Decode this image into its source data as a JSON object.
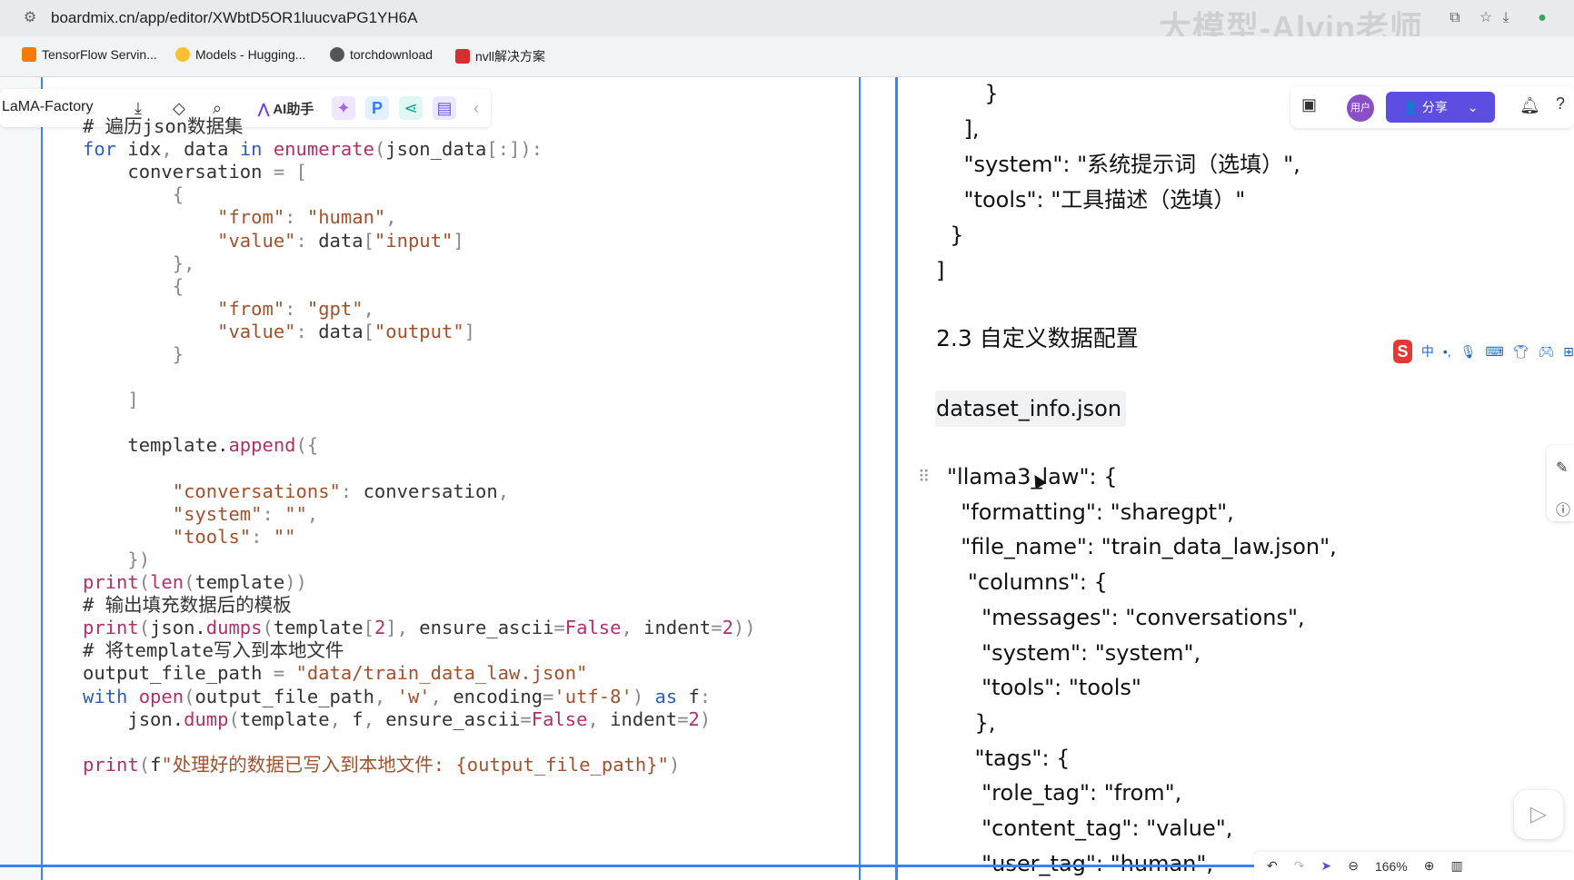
{
  "browser": {
    "url": "boardmix.cn/app/editor/XWbtD5OR1luucvaPG1YH6A",
    "watermark": "大模型-Alvin老师",
    "bookmarks": [
      "TensorFlow Servin...",
      "Models - Hugging...",
      "torchdownload",
      "nvll解决方案"
    ]
  },
  "toolbar": {
    "doc_name": "LaMA-Factory",
    "ai_label": "AI助手"
  },
  "right_bar": {
    "avatar": "用户",
    "share": "分享"
  },
  "ime": {
    "logo": "S",
    "lang": "中"
  },
  "zoom": "166%",
  "code_lines": [
    "# 遍历json数据集",
    "for idx, data in enumerate(json_data[:]):",
    "    conversation = [",
    "        {",
    "            \"from\": \"human\",",
    "            \"value\": data[\"input\"]",
    "        },",
    "        {",
    "            \"from\": \"gpt\",",
    "            \"value\": data[\"output\"]",
    "        }",
    "",
    "    ]",
    "",
    "    template.append({",
    "",
    "        \"conversations\": conversation,",
    "        \"system\": \"\",",
    "        \"tools\": \"\"",
    "    })",
    "print(len(template))",
    "# 输出填充数据后的模板",
    "print(json.dumps(template[2], ensure_ascii=False, indent=2))",
    "# 将template写入到本地文件",
    "output_file_path = \"data/train_data_law.json\"",
    "with open(output_file_path, 'w', encoding='utf-8') as f:",
    "    json.dump(template, f, ensure_ascii=False, indent=2)",
    "",
    "print(f\"处理好的数据已写入到本地文件: {output_file_path}\")"
  ],
  "doc": {
    "top_lines": [
      "       }",
      "    ],",
      "    \"system\": \"系统提示词（选填）\",",
      "    \"tools\": \"工具描述（选填）\"",
      "  }",
      "]"
    ],
    "heading": "2.3 自定义数据配置",
    "file_label": "dataset_info.json",
    "config_lines": [
      "\"llama3_law\": {",
      "  \"formatting\": \"sharegpt\",",
      "  \"file_name\": \"train_data_law.json\",",
      "   \"columns\": {",
      "     \"messages\": \"conversations\",",
      "     \"system\": \"system\",",
      "     \"tools\": \"tools\"",
      "    },",
      "    \"tags\": {",
      "     \"role_tag\": \"from\",",
      "     \"content_tag\": \"value\",",
      "     \"user_tag\": \"human\","
    ]
  }
}
